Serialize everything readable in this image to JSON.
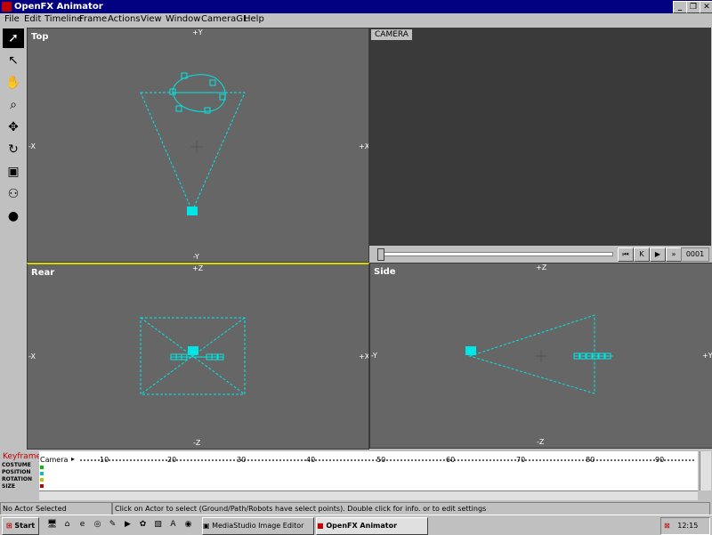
{
  "window": {
    "title": "OpenFX Animator",
    "controls": [
      "_",
      "❐",
      "✕"
    ]
  },
  "menu": [
    "File",
    "Edit",
    "Timeline",
    "Frame",
    "Actions",
    "View",
    "Window",
    "CameraGL",
    "Help"
  ],
  "tools": [
    "select-icon",
    "pointer-icon",
    "hand-pan-icon",
    "zoom-icon",
    "move-icon",
    "rotate-icon",
    "frame-icon",
    "group-icon",
    "sphere-icon"
  ],
  "viewports": {
    "top": {
      "label": "Top",
      "axes": {
        "top": "+Y",
        "bottom": "-Y",
        "left": "-X",
        "right": "+X"
      }
    },
    "rear": {
      "label": "Rear",
      "axes": {
        "top": "+Z",
        "bottom": "-Z",
        "left": "-X",
        "right": "+X"
      }
    },
    "side": {
      "label": "Side",
      "axes": {
        "top": "+Z",
        "bottom": "-Z",
        "left": "-Y",
        "right": "+Y"
      }
    }
  },
  "camera_view": {
    "label": "CAMERA",
    "frame": "0001",
    "buttons": [
      "⏮",
      "K",
      "▶",
      "»"
    ]
  },
  "keyframer": {
    "title": "Keyframer",
    "actor": "Camera",
    "rows": [
      "COSTUME",
      "POSITION",
      "ROTATION",
      "SIZE"
    ],
    "ticks": [
      "10",
      "20",
      "30",
      "40",
      "50",
      "60",
      "70",
      "80",
      "90"
    ]
  },
  "status": {
    "actor": "No Actor Selected",
    "hint": "Click on Actor to select  (Ground/Path/Robots have select points). Double click for info. or to edit settings"
  },
  "taskbar": {
    "start": "Start",
    "items": [
      "MediaStudio Image Editor",
      "OpenFX Animator"
    ],
    "time": "12:15"
  },
  "colors": {
    "wire": "#00e5e5",
    "viewport": "#666666",
    "camera_bg": "#3a3a3a",
    "titlebar": "#000080"
  }
}
